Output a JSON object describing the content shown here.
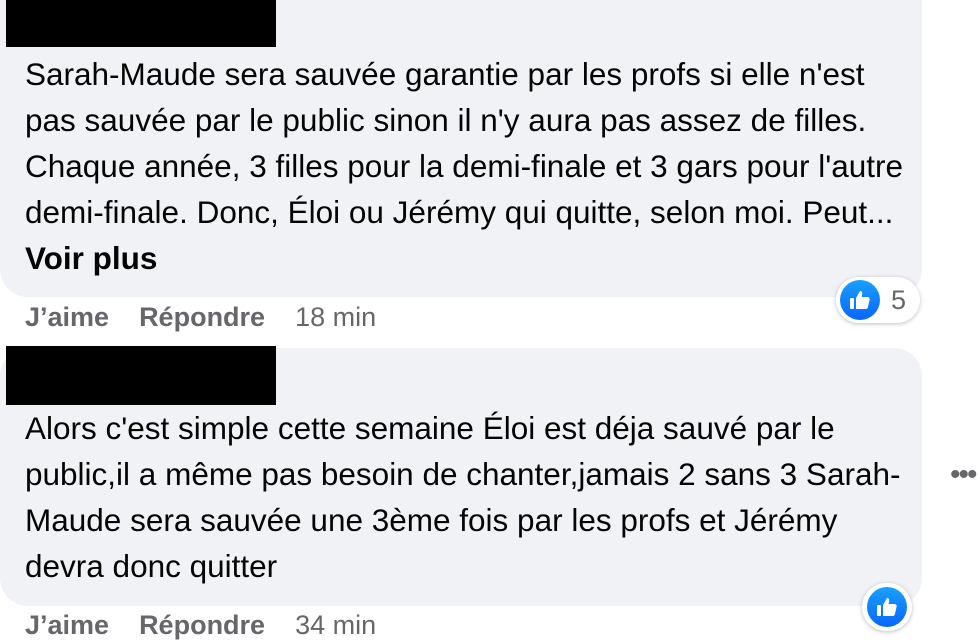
{
  "comments": [
    {
      "author_redacted": true,
      "text": "Sarah-Maude sera sauvée garantie par les profs si elle n'est pas sauvée par le public sinon il n'y aura pas assez de filles. Chaque année, 3 filles pour la demi-finale et 3 gars pour l'autre demi-finale. Donc, Éloi ou Jérémy qui quitte, selon moi. Peut...",
      "see_more": "Voir plus",
      "like_label": "J’aime",
      "reply_label": "Répondre",
      "time": "18 min",
      "reaction_icon": "thumbs-up-icon",
      "reaction_count": "5"
    },
    {
      "author_redacted": true,
      "text": "Alors c'est simple cette semaine Éloi est déja sauvé par le public,il a même pas besoin de chanter,jamais 2 sans 3 Sarah-Maude sera sauvée une 3ème fois par les profs et Jérémy devra donc quitter",
      "like_label": "J’aime",
      "reply_label": "Répondre",
      "time": "34 min",
      "reaction_icon": "thumbs-up-icon"
    }
  ],
  "more_options_icon": "more-options-icon",
  "colors": {
    "bubble": "#f0f2f5",
    "text": "#050505",
    "secondary": "#65676b",
    "like_blue": "#0866ff",
    "redaction": "#000000"
  }
}
